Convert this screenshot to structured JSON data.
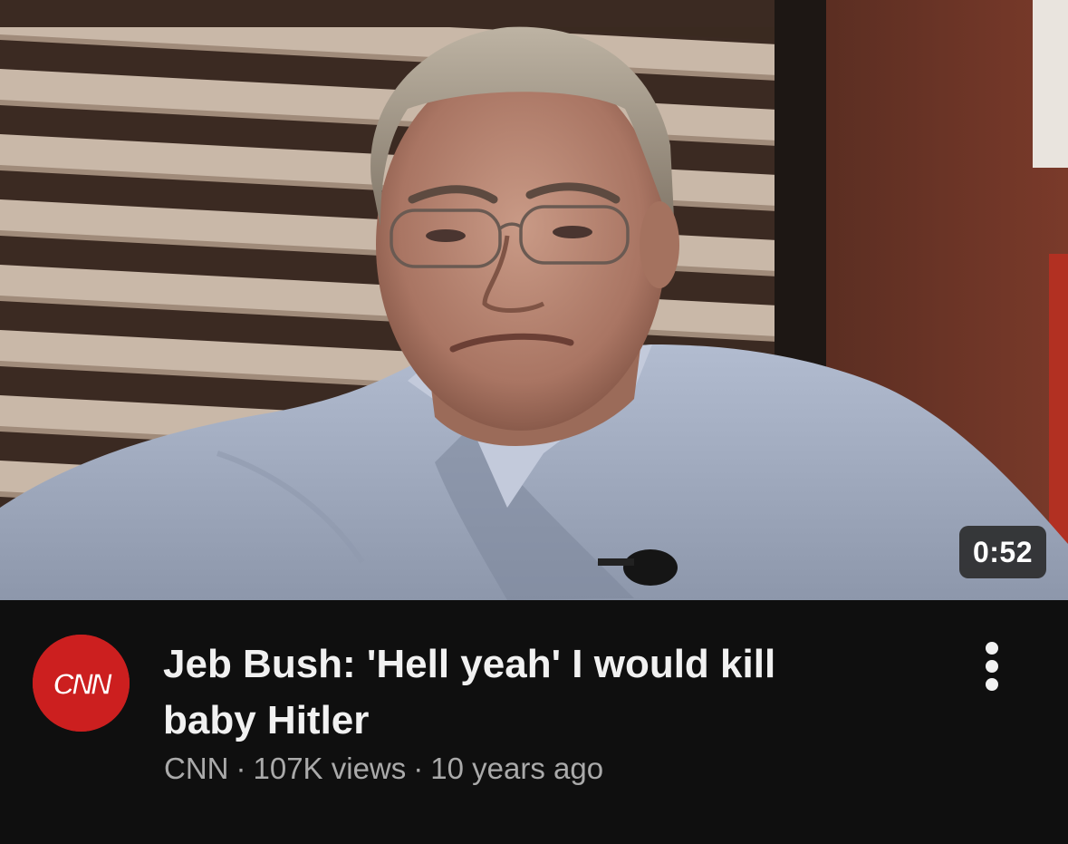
{
  "video": {
    "duration": "0:52",
    "title": "Jeb Bush: 'Hell yeah' I would kill baby Hitler",
    "channel": "CNN",
    "views": "107K views",
    "age": "10 years ago",
    "separator": "·"
  },
  "channel_avatar": {
    "logo_text": "CNN",
    "color": "#cc1f1f"
  },
  "icons": {
    "more": "more-vert-icon"
  },
  "colors": {
    "background": "#0f0f0f",
    "title": "#f1f1f1",
    "meta": "#aaaaaa"
  }
}
